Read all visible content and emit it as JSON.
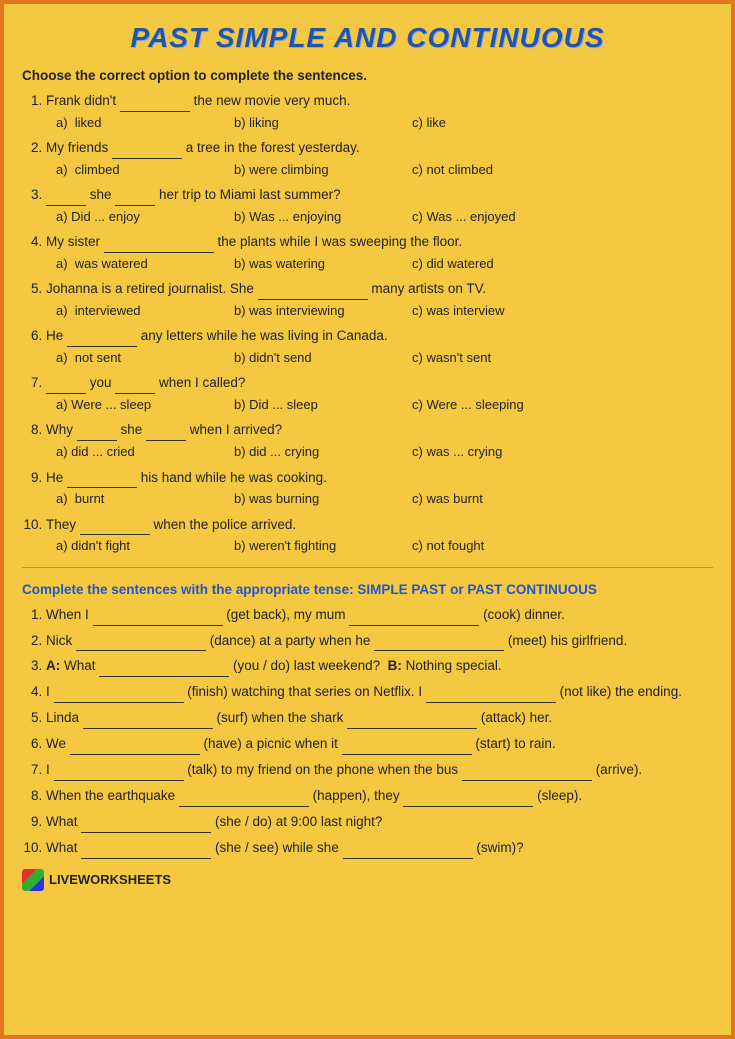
{
  "title": "PAST SIMPLE AND CONTINUOUS",
  "section1": {
    "instruction": "Choose the correct option to complete the sentences.",
    "questions": [
      {
        "num": 1,
        "text_before": "Frank didn't",
        "blank": true,
        "text_after": "the new movie very much.",
        "options": [
          {
            "label": "a)",
            "text": "liked"
          },
          {
            "label": "b)",
            "text": "liking"
          },
          {
            "label": "c)",
            "text": "like"
          }
        ]
      },
      {
        "num": 2,
        "text_before": "My friends",
        "blank": true,
        "text_after": "a tree in the forest yesterday.",
        "options": [
          {
            "label": "a)",
            "text": "climbed"
          },
          {
            "label": "b)",
            "text": "were climbing"
          },
          {
            "label": "c)",
            "text": "not climbed"
          }
        ]
      },
      {
        "num": 3,
        "text_before": "",
        "blank": true,
        "text_after": "she",
        "blank2": true,
        "text_after2": "her trip to Miami last summer?",
        "options": [
          {
            "label": "a)",
            "text": "Did ... enjoy"
          },
          {
            "label": "b)",
            "text": "Was ... enjoying"
          },
          {
            "label": "c)",
            "text": "Was ... enjoyed"
          }
        ]
      },
      {
        "num": 4,
        "text_before": "My sister",
        "blank": true,
        "text_after": "the plants while I was sweeping the floor.",
        "options": [
          {
            "label": "a)",
            "text": "was watered"
          },
          {
            "label": "b)",
            "text": "was watering"
          },
          {
            "label": "c)",
            "text": "did watered"
          }
        ]
      },
      {
        "num": 5,
        "text_before": "Johanna is a retired journalist. She",
        "blank": true,
        "text_after": "many artists on TV.",
        "options": [
          {
            "label": "a)",
            "text": "interviewed"
          },
          {
            "label": "b)",
            "text": "was interviewing"
          },
          {
            "label": "c)",
            "text": "was interview"
          }
        ]
      },
      {
        "num": 6,
        "text_before": "He",
        "blank": true,
        "text_after": "any letters while he was living in Canada.",
        "options": [
          {
            "label": "a)",
            "text": "not sent"
          },
          {
            "label": "b)",
            "text": "didn't send"
          },
          {
            "label": "c)",
            "text": "wasn't sent"
          }
        ]
      },
      {
        "num": 7,
        "text_before": "",
        "blank": true,
        "text_mid": "you",
        "blank2": true,
        "text_after": "when I called?",
        "options": [
          {
            "label": "a)",
            "text": "Were ... sleep"
          },
          {
            "label": "b)",
            "text": "Did ... sleep"
          },
          {
            "label": "c)",
            "text": "Were ... sleeping"
          }
        ]
      },
      {
        "num": 8,
        "text_before": "Why",
        "blank": true,
        "text_mid": "she",
        "blank2": true,
        "text_after": "when I arrived?",
        "options": [
          {
            "label": "a)",
            "text": "did ... cried"
          },
          {
            "label": "b)",
            "text": "did ... crying"
          },
          {
            "label": "c)",
            "text": "was ... crying"
          }
        ]
      },
      {
        "num": 9,
        "text_before": "He",
        "blank": true,
        "text_after": "his hand while he was cooking.",
        "options": [
          {
            "label": "a)",
            "text": "burnt"
          },
          {
            "label": "b)",
            "text": "was burning"
          },
          {
            "label": "c)",
            "text": "was burnt"
          }
        ]
      },
      {
        "num": 10,
        "text_before": "They",
        "blank": true,
        "text_after": "when the police arrived.",
        "options": [
          {
            "label": "a)",
            "text": "didn't fight"
          },
          {
            "label": "b)",
            "text": "weren't fighting"
          },
          {
            "label": "c)",
            "text": "not fought"
          }
        ]
      }
    ]
  },
  "section2": {
    "instruction_static": "Complete the sentences with the appropriate tense:",
    "instruction_colored": "SIMPLE PAST or PAST CONTINUOUS",
    "questions": [
      {
        "num": 1,
        "text": "When I _____________ (get back), my mum _____________ (cook) dinner."
      },
      {
        "num": 2,
        "text": "Nick _____________ (dance) at a party when he _____________ (meet) his girlfriend."
      },
      {
        "num": 3,
        "text": "A: What _____________ (you / do) last weekend?  B: Nothing special."
      },
      {
        "num": 4,
        "text": "I _____________ (finish) watching that series on Netflix. I _____________ (not like) the ending."
      },
      {
        "num": 5,
        "text": "Linda _____________ (surf) when the shark _____________ (attack) her."
      },
      {
        "num": 6,
        "text": "We _____________ (have) a picnic when it _____________ (start) to rain."
      },
      {
        "num": 7,
        "text": "I _____________ (talk) to my friend on the phone when the bus _____________ (arrive)."
      },
      {
        "num": 8,
        "text": "When the earthquake _____________ (happen), they _____________ (sleep)."
      },
      {
        "num": 9,
        "text": "What _____________ (she / do) at 9:00 last night?"
      },
      {
        "num": 10,
        "text": "What _____________ (she / see) while she _____________ (swim)?"
      }
    ]
  },
  "footer": {
    "logo_label": "LW",
    "brand": "LIVEWORKSHEETS"
  }
}
